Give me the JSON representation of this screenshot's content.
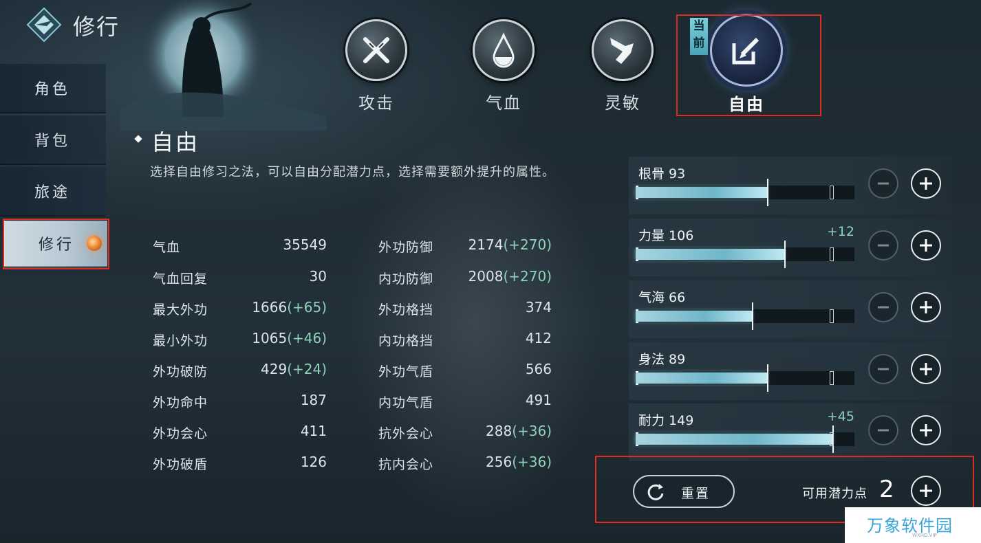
{
  "header": {
    "title": "修行",
    "logo_icon": "diamond-emblem-icon"
  },
  "sidebar": {
    "items": [
      {
        "label": "角色",
        "active": false
      },
      {
        "label": "背包",
        "active": false
      },
      {
        "label": "旅途",
        "active": false
      },
      {
        "label": "修行",
        "active": true,
        "indicator_icon": "orange-orb-icon"
      }
    ]
  },
  "tabs": [
    {
      "label": "攻击",
      "icon": "crossed-swords-icon"
    },
    {
      "label": "气血",
      "icon": "blood-drop-icon"
    },
    {
      "label": "灵敏",
      "icon": "wing-icon"
    },
    {
      "label": "自由",
      "icon": "edit-icon",
      "current": true,
      "badge": "当前"
    }
  ],
  "section": {
    "title": "自由",
    "description": "选择自由修习之法，可以自由分配潜力点，选择需要额外提升的属性。"
  },
  "stats": {
    "left": [
      {
        "name": "气血",
        "value": "35549",
        "bonus": ""
      },
      {
        "name": "气血回复",
        "value": "30",
        "bonus": ""
      },
      {
        "name": "最大外功",
        "value": "1666",
        "bonus": "(+65)"
      },
      {
        "name": "最小外功",
        "value": "1065",
        "bonus": "(+46)"
      },
      {
        "name": "外功破防",
        "value": "429",
        "bonus": "(+24)"
      },
      {
        "name": "外功命中",
        "value": "187",
        "bonus": ""
      },
      {
        "name": "外功会心",
        "value": "411",
        "bonus": ""
      },
      {
        "name": "外功破盾",
        "value": "126",
        "bonus": ""
      }
    ],
    "right": [
      {
        "name": "外功防御",
        "value": "2174",
        "bonus": "(+270)"
      },
      {
        "name": "内功防御",
        "value": "2008",
        "bonus": "(+270)"
      },
      {
        "name": "外功格挡",
        "value": "374",
        "bonus": ""
      },
      {
        "name": "内功格挡",
        "value": "412",
        "bonus": ""
      },
      {
        "name": "外功气盾",
        "value": "566",
        "bonus": ""
      },
      {
        "name": "内功气盾",
        "value": "491",
        "bonus": ""
      },
      {
        "name": "抗外会心",
        "value": "288",
        "bonus": "(+36)"
      },
      {
        "name": "抗内会心",
        "value": "256",
        "bonus": "(+36)"
      }
    ]
  },
  "attributes": [
    {
      "label": "根骨 93",
      "bonus": "",
      "fill_fraction": 0.6
    },
    {
      "label": "力量 106",
      "bonus": "+12",
      "fill_fraction": 0.68
    },
    {
      "label": "气海 66",
      "bonus": "",
      "fill_fraction": 0.53
    },
    {
      "label": "身法 89",
      "bonus": "",
      "fill_fraction": 0.6
    },
    {
      "label": "耐力 149",
      "bonus": "+45",
      "fill_fraction": 0.9
    }
  ],
  "footer": {
    "reset_label": "重置",
    "potential_label": "可用潜力点",
    "potential_value": "2"
  },
  "watermark": {
    "text": "万象软件园",
    "sub": "WXHD.VIP"
  },
  "colors": {
    "bonus_green": "#8fd2b9",
    "highlight_red": "#e02b1f",
    "bar_cyan": "#6fb6c9"
  }
}
